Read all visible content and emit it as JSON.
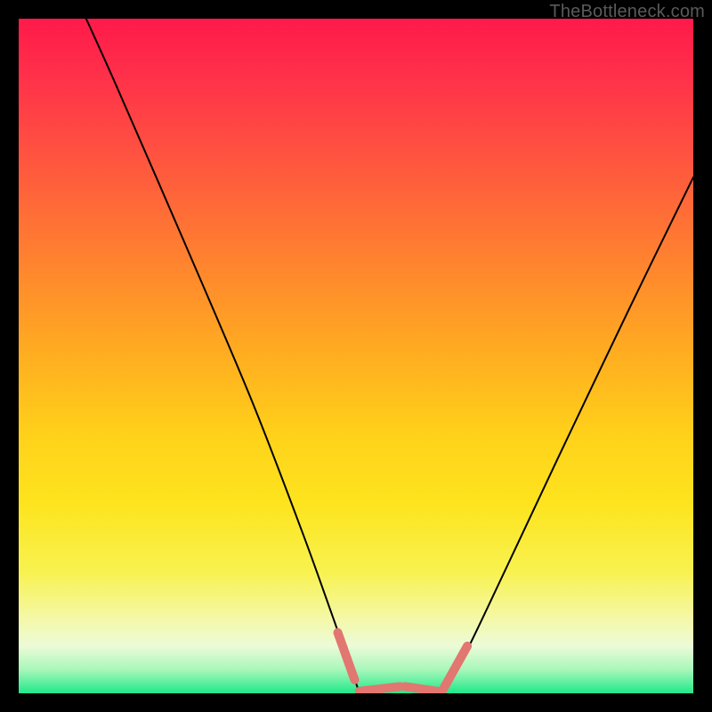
{
  "watermark": {
    "text": "TheBottleneck.com"
  },
  "chart_data": {
    "type": "line",
    "title": "",
    "xlabel": "",
    "ylabel": "",
    "xlim": [
      0,
      100
    ],
    "ylim": [
      0,
      100
    ],
    "series": [
      {
        "name": "left-branch",
        "x": [
          10.0,
          14.5,
          24.5,
          34.5,
          42.0,
          46.5,
          49.5,
          51.0
        ],
        "y": [
          100.0,
          90.0,
          67.0,
          43.5,
          24.0,
          11.5,
          3.0,
          0.0
        ]
      },
      {
        "name": "valley-floor",
        "x": [
          51.0,
          55.0,
          59.0,
          62.5
        ],
        "y": [
          0.0,
          0.6,
          0.6,
          0.0
        ]
      },
      {
        "name": "right-branch",
        "x": [
          62.5,
          66.0,
          72.0,
          80.0,
          90.5,
          100.0
        ],
        "y": [
          0.0,
          5.5,
          18.0,
          35.0,
          57.0,
          76.5
        ]
      }
    ],
    "accent_dashes": {
      "color": "#e27670",
      "stroke_width": 10,
      "segments": [
        {
          "x1": 47.3,
          "y1": 9.0,
          "x2": 49.8,
          "y2": 2.0
        },
        {
          "x1": 50.5,
          "y1": 0.3,
          "x2": 56.5,
          "y2": 1.0
        },
        {
          "x1": 57.3,
          "y1": 1.0,
          "x2": 62.7,
          "y2": 0.2
        },
        {
          "x1": 62.7,
          "y1": 0.2,
          "x2": 66.5,
          "y2": 7.0
        }
      ]
    },
    "background_gradient": {
      "top": "#ff1a4a",
      "bottom": "#1fe88a"
    }
  }
}
